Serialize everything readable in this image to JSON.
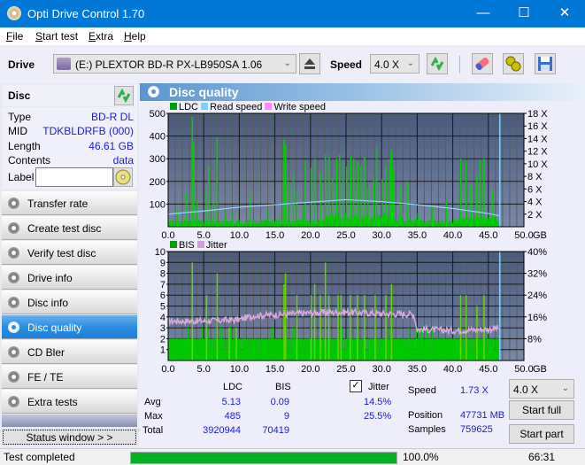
{
  "window": {
    "title": "Opti Drive Control 1.70",
    "minimize": "—",
    "maximize": "☐",
    "close": "✕"
  },
  "menu": [
    {
      "label": "File",
      "u": "F",
      "rest": "ile"
    },
    {
      "label": "Start test",
      "u": "S",
      "rest": "tart test"
    },
    {
      "label": "Extra",
      "u": "E",
      "rest": "xtra"
    },
    {
      "label": "Help",
      "u": "H",
      "rest": "elp"
    }
  ],
  "toolbar": {
    "drive_label": "Drive",
    "drive_value": "(E:)  PLEXTOR BD-R  PX-LB950SA 1.06",
    "speed_label": "Speed",
    "speed_value": "4.0 X"
  },
  "disc": {
    "header": "Disc",
    "fields": [
      {
        "label": "Type",
        "value": "BD-R DL"
      },
      {
        "label": "MID",
        "value": "TDKBLDRFB (000)"
      },
      {
        "label": "Length",
        "value": "46.61 GB"
      },
      {
        "label": "Contents",
        "value": "data"
      }
    ],
    "label_field": "Label",
    "label_value": ""
  },
  "nav": [
    {
      "label": "Transfer rate",
      "active": false
    },
    {
      "label": "Create test disc",
      "active": false
    },
    {
      "label": "Verify test disc",
      "active": false
    },
    {
      "label": "Drive info",
      "active": false
    },
    {
      "label": "Disc info",
      "active": false
    },
    {
      "label": "Disc quality",
      "active": true
    },
    {
      "label": "CD Bler",
      "active": false
    },
    {
      "label": "FE / TE",
      "active": false
    },
    {
      "label": "Extra tests",
      "active": false
    }
  ],
  "status_window_btn": "Status window > >",
  "main": {
    "title": "Disc quality"
  },
  "chart_data": [
    {
      "type": "bar",
      "title": "LDC",
      "legend": [
        "LDC",
        "Read speed",
        "Write speed"
      ],
      "legend_colors": [
        "#00a000",
        "#7fcfff",
        "#ff8cff"
      ],
      "xlabel": "GB",
      "xlim": [
        0,
        50
      ],
      "x_ticks": [
        "0.0",
        "5.0",
        "10.0",
        "15.0",
        "20.0",
        "25.0",
        "30.0",
        "35.0",
        "40.0",
        "45.0",
        "50.0"
      ],
      "ylim_left": [
        0,
        500
      ],
      "y_ticks_left": [
        "500",
        "400",
        "300",
        "200",
        "100"
      ],
      "ylim_right": [
        0,
        18
      ],
      "y_ticks_right": [
        "18 X",
        "16 X",
        "14 X",
        "12 X",
        "10 X",
        "8 X",
        "6 X",
        "4 X",
        "2 X"
      ],
      "ldc_spikes": [
        [
          0.3,
          20
        ],
        [
          1.2,
          75
        ],
        [
          2.5,
          150
        ],
        [
          3.3,
          485
        ],
        [
          3.5,
          370
        ],
        [
          4.0,
          120
        ],
        [
          5.3,
          160
        ],
        [
          5.6,
          270
        ],
        [
          6.3,
          110
        ],
        [
          6.8,
          395
        ],
        [
          8.0,
          70
        ],
        [
          9.0,
          60
        ],
        [
          11.5,
          140
        ],
        [
          14.0,
          80
        ],
        [
          15.5,
          60
        ],
        [
          16.2,
          385
        ],
        [
          16.4,
          360
        ],
        [
          16.8,
          200
        ],
        [
          17.5,
          240
        ],
        [
          18.0,
          160
        ],
        [
          18.8,
          90
        ],
        [
          19.2,
          290
        ],
        [
          20.0,
          260
        ],
        [
          20.5,
          300
        ],
        [
          21.3,
          235
        ],
        [
          22.0,
          320
        ],
        [
          22.5,
          310
        ],
        [
          23.0,
          215
        ],
        [
          23.6,
          300
        ],
        [
          24.0,
          320
        ],
        [
          24.5,
          290
        ],
        [
          25.0,
          265
        ],
        [
          25.6,
          310
        ],
        [
          26.0,
          300
        ],
        [
          26.6,
          285
        ],
        [
          27.0,
          265
        ],
        [
          27.5,
          310
        ],
        [
          28.0,
          170
        ],
        [
          28.8,
          205
        ],
        [
          29.2,
          355
        ],
        [
          30.0,
          210
        ],
        [
          30.5,
          270
        ],
        [
          31.0,
          300
        ],
        [
          31.3,
          340
        ],
        [
          31.6,
          255
        ],
        [
          32.5,
          175
        ],
        [
          33.5,
          200
        ],
        [
          35.0,
          60
        ],
        [
          37.0,
          90
        ],
        [
          39.0,
          110
        ],
        [
          41.0,
          300
        ],
        [
          41.8,
          290
        ],
        [
          42.5,
          180
        ],
        [
          43.3,
          230
        ],
        [
          43.8,
          295
        ],
        [
          44.3,
          300
        ],
        [
          45.5,
          160
        ],
        [
          46.5,
          150
        ]
      ],
      "ldc_baseline": 25,
      "read_speed": [
        [
          0,
          2.0
        ],
        [
          5,
          2.5
        ],
        [
          10,
          3.1
        ],
        [
          15,
          3.5
        ],
        [
          20,
          3.9
        ],
        [
          25,
          4.3
        ],
        [
          30,
          4.0
        ],
        [
          35,
          3.5
        ],
        [
          40,
          2.9
        ],
        [
          45,
          2.1
        ],
        [
          46.6,
          1.73
        ]
      ],
      "end_marker_gb": 46.61
    },
    {
      "type": "bar",
      "title": "BIS",
      "legend": [
        "BIS",
        "Jitter"
      ],
      "legend_colors": [
        "#00a000",
        "#d0a0d8"
      ],
      "xlabel": "GB",
      "xlim": [
        0,
        50
      ],
      "x_ticks": [
        "0.0",
        "5.0",
        "10.0",
        "15.0",
        "20.0",
        "25.0",
        "30.0",
        "35.0",
        "40.0",
        "45.0",
        "50.0"
      ],
      "ylim_left": [
        0,
        10
      ],
      "y_ticks_left": [
        "10",
        "9",
        "8",
        "7",
        "6",
        "5",
        "4",
        "3",
        "2",
        "1"
      ],
      "ylim_right": [
        0,
        40
      ],
      "y_ticks_right": [
        "40%",
        "32%",
        "24%",
        "16%",
        "8%"
      ],
      "bis_spikes": [
        [
          3.3,
          9
        ],
        [
          5.3,
          6
        ],
        [
          6.8,
          8
        ],
        [
          8.5,
          3
        ],
        [
          9.5,
          3
        ],
        [
          16.2,
          7
        ],
        [
          16.4,
          8
        ],
        [
          18.0,
          6
        ],
        [
          20.0,
          6
        ],
        [
          20.5,
          7
        ],
        [
          21.3,
          6
        ],
        [
          22.0,
          9
        ],
        [
          22.5,
          6
        ],
        [
          23.8,
          6
        ],
        [
          24.2,
          6
        ],
        [
          25.5,
          6
        ],
        [
          26.5,
          6
        ],
        [
          27.5,
          6
        ],
        [
          29.0,
          6
        ],
        [
          30.5,
          6
        ],
        [
          31.3,
          7
        ],
        [
          41.0,
          6
        ],
        [
          41.8,
          6
        ],
        [
          43.3,
          5
        ],
        [
          44.3,
          6
        ],
        [
          46.5,
          3
        ]
      ],
      "bis_baseline": 2,
      "jitter": [
        [
          0,
          14.5
        ],
        [
          5,
          14.5
        ],
        [
          10,
          15
        ],
        [
          12,
          16.5
        ],
        [
          15,
          16.8
        ],
        [
          20,
          17.5
        ],
        [
          25,
          17.8
        ],
        [
          30,
          17.2
        ],
        [
          34.5,
          17
        ],
        [
          35,
          11.5
        ],
        [
          40,
          11
        ],
        [
          45,
          11.5
        ],
        [
          46.6,
          12
        ]
      ],
      "end_marker_gb": 46.61
    }
  ],
  "stats": {
    "col_ldc": "LDC",
    "col_bis": "BIS",
    "jitter_label": "Jitter",
    "jitter_checked": true,
    "rows": [
      {
        "label": "Avg",
        "ldc": "5.13",
        "bis": "0.09",
        "jitter": "14.5%"
      },
      {
        "label": "Max",
        "ldc": "485",
        "bis": "9",
        "jitter": "25.5%"
      },
      {
        "label": "Total",
        "ldc": "3920944",
        "bis": "70419",
        "jitter": ""
      }
    ],
    "speed_label": "Speed",
    "speed_value": "1.73 X",
    "position_label": "Position",
    "position_value": "47731 MB",
    "samples_label": "Samples",
    "samples_value": "759625",
    "speed_select": "4.0 X",
    "start_full": "Start full",
    "start_part": "Start part"
  },
  "statusbar": {
    "text": "Test completed",
    "progress": 100.0,
    "progress_text": "100.0%",
    "time": "66:31"
  }
}
